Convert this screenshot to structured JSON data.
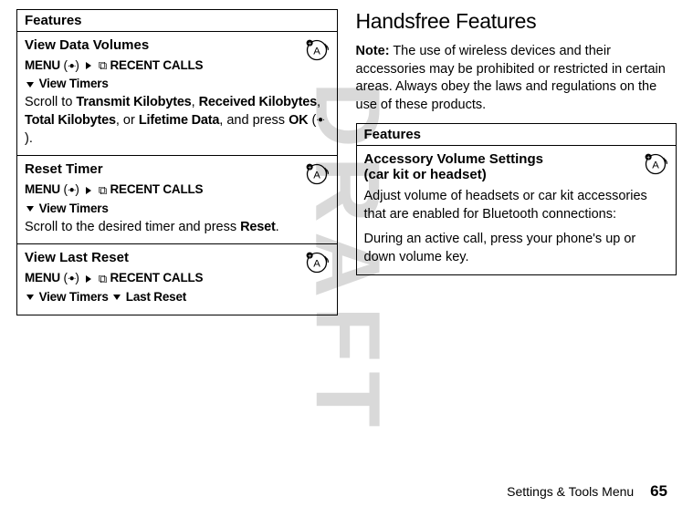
{
  "watermark": "DRAFT",
  "left": {
    "features_label": "Features",
    "rows": [
      {
        "title": "View Data Volumes",
        "menu_label": "MENU",
        "recent_calls": "RECENT CALLS",
        "sub1": "View Timers",
        "body_pre": "Scroll to ",
        "b1": "Transmit Kilobytes",
        "c1": ", ",
        "b2": "Received Kilobytes",
        "c2": ", ",
        "b3": "Total Kilobytes",
        "c3": ", or ",
        "b4": "Lifetime Data",
        "body_mid": ", and press ",
        "ok": "OK",
        "body_post": " (",
        "body_end": ")."
      },
      {
        "title": "Reset Timer",
        "menu_label": "MENU",
        "recent_calls": "RECENT CALLS",
        "sub1": "View Timers",
        "body_pre": "Scroll to the desired timer and press ",
        "reset": "Reset",
        "body_post": "."
      },
      {
        "title": "View Last Reset",
        "menu_label": "MENU",
        "recent_calls": "RECENT CALLS",
        "sub1": "View Timers",
        "sub2": "Last Reset"
      }
    ]
  },
  "right": {
    "heading": "Handsfree Features",
    "note_label": "Note:",
    "note_body": " The use of wireless devices and their accessories may be prohibited or restricted in certain areas. Always obey the laws and regulations on the use of these products.",
    "features_label": "Features",
    "row": {
      "title1": "Accessory Volume Settings",
      "title2": "(car kit or headset)",
      "body1": "Adjust volume of headsets or car kit accessories that are enabled for Bluetooth connections:",
      "body2": "During an active call, press your phone's up or down volume key."
    }
  },
  "footer": {
    "section": "Settings & Tools Menu",
    "page": "65"
  }
}
